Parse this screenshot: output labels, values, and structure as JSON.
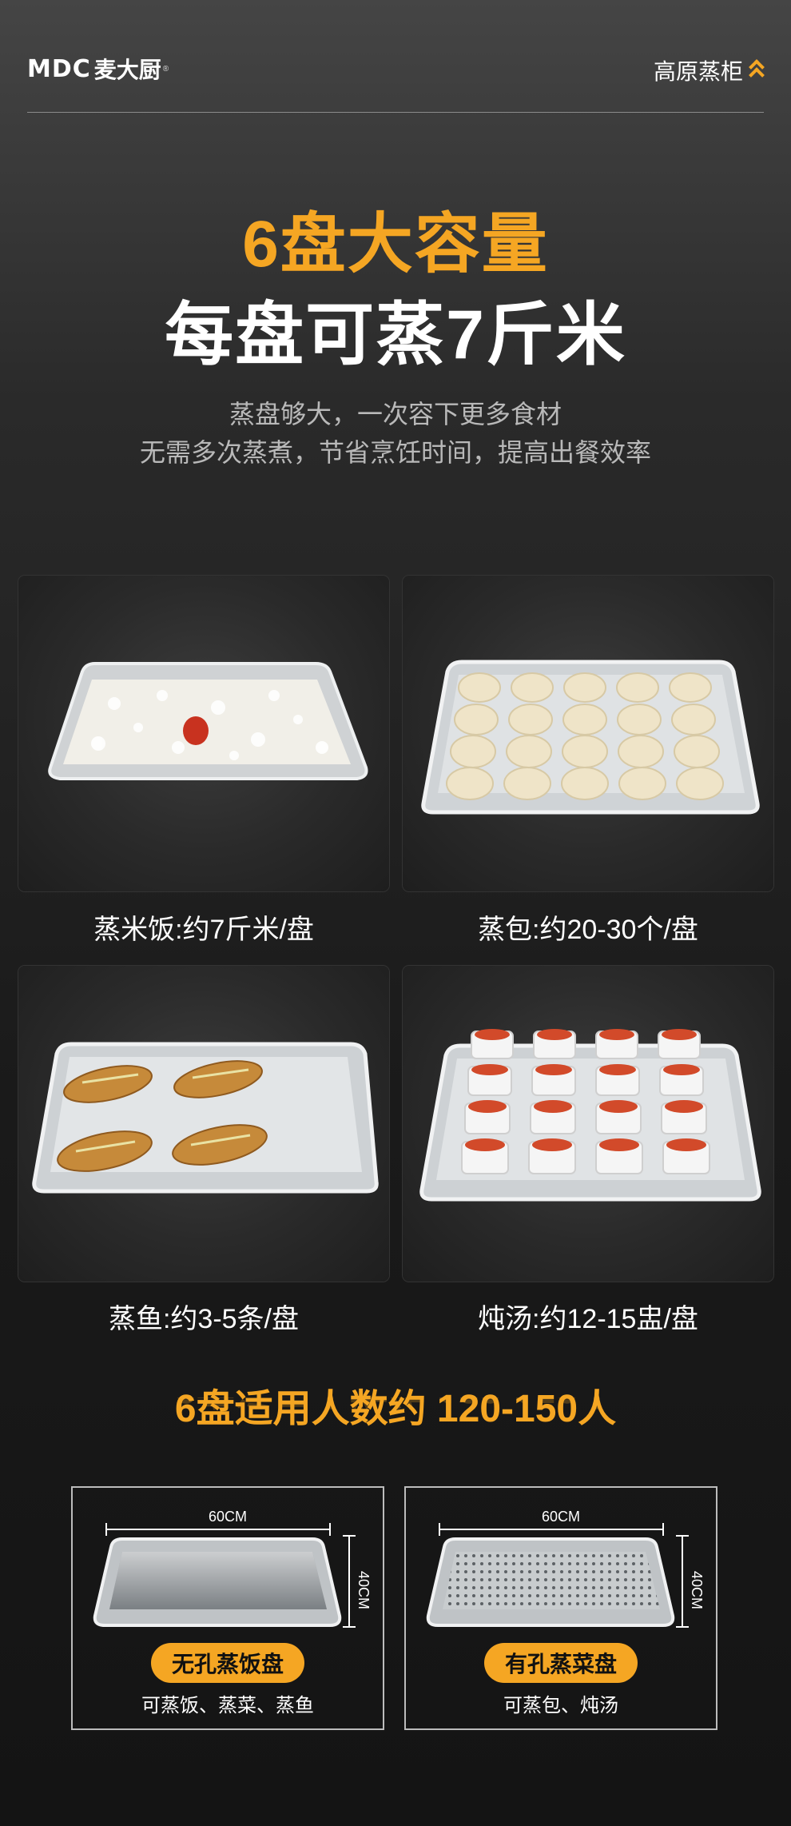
{
  "header": {
    "logo_mark": "MDC",
    "logo_cn": "麦大厨",
    "logo_reg": "®",
    "product": "高原蒸柜"
  },
  "headline": {
    "line1": "6盘大容量",
    "line2": "每盘可蒸7斤米"
  },
  "subtitle": {
    "line1": "蒸盘够大，一次容下更多食材",
    "line2": "无需多次蒸煮，节省烹饪时间，提高出餐效率"
  },
  "capacity_items": [
    {
      "label": "蒸米饭:约7斤米/盘"
    },
    {
      "label": "蒸包:约20-30个/盘"
    },
    {
      "label": "蒸鱼:约3-5条/盘"
    },
    {
      "label": "炖汤:约12-15盅/盘"
    }
  ],
  "serves": "6盘适用人数约 120-150人",
  "trays": [
    {
      "width": "60CM",
      "depth": "40CM",
      "name": "无孔蒸饭盘",
      "use": "可蒸饭、蒸菜、蒸鱼"
    },
    {
      "width": "60CM",
      "depth": "40CM",
      "name": "有孔蒸菜盘",
      "use": "可蒸包、炖汤"
    }
  ],
  "colors": {
    "accent": "#f5a623",
    "background": "#1a1a1a",
    "text": "#ffffff",
    "muted": "#b9b9b9"
  }
}
